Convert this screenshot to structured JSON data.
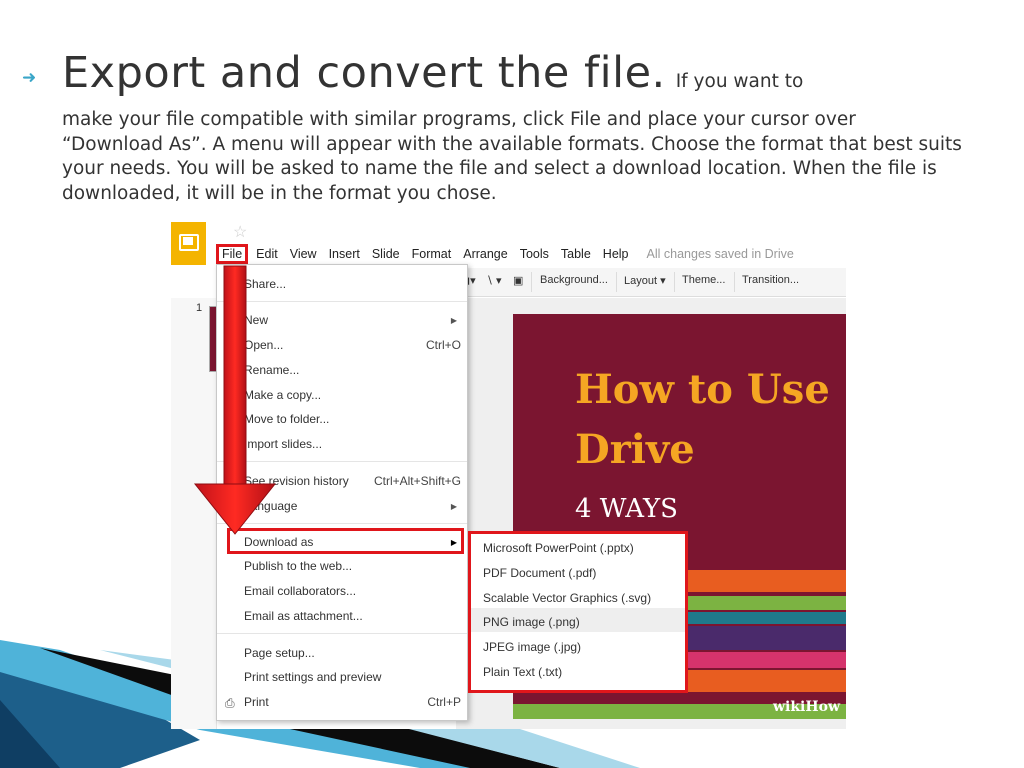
{
  "slide": {
    "title": "Export and convert the file.",
    "title_tail": "If you want to",
    "body": "make your file compatible with similar programs, click File and place your cursor over “Download As”. A menu will appear with the available formats. Choose the format that best suits your needs. You will be asked to name the file and select a download location. When the file is downloaded, it will be in the format you chose."
  },
  "app": {
    "menu": [
      "File",
      "Edit",
      "View",
      "Insert",
      "Slide",
      "Format",
      "Arrange",
      "Tools",
      "Table",
      "Help"
    ],
    "save_status": "All changes saved in Drive",
    "toolbar": {
      "background": "Background...",
      "layout": "Layout ▾",
      "theme": "Theme...",
      "transition": "Transition..."
    },
    "slide_number": "1"
  },
  "file_menu": {
    "share": "Share...",
    "new": "New",
    "open": "Open...",
    "open_shortcut": "Ctrl+O",
    "rename": "Rename...",
    "make_copy": "Make a copy...",
    "move_to_folder": "Move to folder...",
    "import_slides": "Import slides...",
    "revision_history": "See revision history",
    "revision_shortcut": "Ctrl+Alt+Shift+G",
    "language": "Language",
    "download_as": "Download as",
    "publish": "Publish to the web...",
    "email_collaborators": "Email collaborators...",
    "email_attachment": "Email as attachment...",
    "page_setup": "Page setup...",
    "print_settings": "Print settings and preview",
    "print": "Print",
    "print_shortcut": "Ctrl+P"
  },
  "download_submenu": [
    "Microsoft PowerPoint (.pptx)",
    "PDF Document (.pdf)",
    "Scalable Vector Graphics (.svg)",
    "PNG image (.png)",
    "JPEG image (.jpg)",
    "Plain Text (.txt)"
  ],
  "preview_slide": {
    "line1": "How to Use",
    "line2": "Drive",
    "line3": "4 WAYS",
    "watermark": "wikiHow"
  },
  "colors": {
    "highlight_red": "#e0161b",
    "slide_bg": "#7b1530",
    "slide_title": "#f5a623",
    "logo_yellow": "#f4b400",
    "accent_blue": "#3aa6c8"
  }
}
